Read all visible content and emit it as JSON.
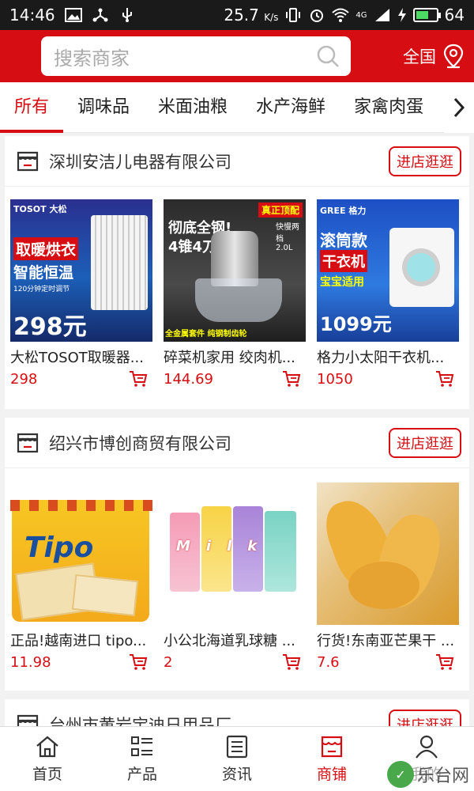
{
  "status_bar": {
    "time": "14:46",
    "network_speed": "25.7",
    "network_unit": "K/s",
    "signal_label": "4G",
    "battery": "64",
    "battery_level": 0.64
  },
  "header": {
    "search_placeholder": "搜索商家",
    "region": "全国"
  },
  "tabs": [
    "所有",
    "调味品",
    "米面油粮",
    "水产海鲜",
    "家禽肉蛋"
  ],
  "stores": [
    {
      "name": "深圳安洁儿电器有限公司",
      "visit_label": "进店逛逛",
      "products": [
        {
          "name": "大松TOSOT取暖器...",
          "price": "298",
          "img_brand": "TOSOT 大松",
          "img_headline": "取暖烘衣",
          "img_sub": "智能恒温",
          "img_note": "120分钟定时调节",
          "img_price": "298元"
        },
        {
          "name": "碎菜机家用 绞肉机...",
          "price": "144.69",
          "img_brand": "真正顶配",
          "img_headline": "彻底全钢!",
          "img_sub": "4锥4刀头",
          "img_note": "全金属套件 纯钢制齿轮",
          "img_price": "快慢两档 2.0L"
        },
        {
          "name": "格力小太阳干衣机...",
          "price": "1050",
          "img_brand": "GREE 格力",
          "img_headline": "滚筒款",
          "img_sub": "干衣机",
          "img_note": "宝宝适用",
          "img_price": "1099元"
        }
      ]
    },
    {
      "name": "绍兴市博创商贸有限公司",
      "visit_label": "进店逛逛",
      "products": [
        {
          "name": "正品!越南进口 tipo...",
          "price": "11.98",
          "img_brand": "Tipo"
        },
        {
          "name": "小公北海道乳球糖 ...",
          "price": "2",
          "img_brand": "Milk"
        },
        {
          "name": "行货!东南亚芒果干 ...",
          "price": "7.6"
        }
      ]
    },
    {
      "name": "台州市黄岩宝迪日用品厂",
      "visit_label": "进店逛逛"
    }
  ],
  "bottom_nav": [
    {
      "label": "首页",
      "icon": "home-icon"
    },
    {
      "label": "产品",
      "icon": "list-icon"
    },
    {
      "label": "资讯",
      "icon": "news-icon"
    },
    {
      "label": "商铺",
      "icon": "shop-icon",
      "active": true
    },
    {
      "label": "我的",
      "icon": "user-icon"
    }
  ],
  "watermark": "乐台网",
  "colors": {
    "accent": "#d60e13",
    "background": "#f2f2f2"
  }
}
